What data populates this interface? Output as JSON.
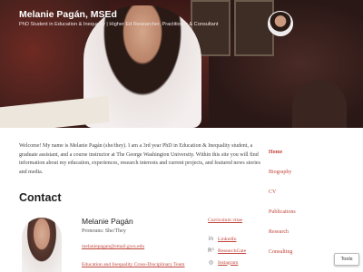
{
  "header": {
    "site_title": "Melanie Pagán, MSEd",
    "tagline": "PhD Student in Education & Inequality | Higher Ed Researcher, Practitioner & Consultant"
  },
  "intro": "Welcome! My name is Melanie Pagán (she/they). I am a 3rd year PhD in Education & Inequality student, a graduate assistant, and a course instructor at The George Washington University. Within this site you will find information about my education, experiences, research interests and current projects, and featured news stories and media.",
  "contact": {
    "heading": "Contact",
    "name": "Melanie Pagán",
    "pronouns": "Pronouns: She/They",
    "email": "melaniepagan@email.gwu.edu",
    "team_link": "Education and Inequality Cross-Disciplinary Team",
    "cv_link": "Curriculum vitae",
    "social": [
      {
        "icon": "linkedin-icon",
        "glyph": "in",
        "label": "LinkedIn"
      },
      {
        "icon": "researchgate-icon",
        "glyph": "Rᴳ",
        "label": "ResearchGate"
      },
      {
        "icon": "instagram-icon",
        "glyph": "◎",
        "label": "Instagram"
      }
    ]
  },
  "nav": {
    "items": [
      "Home",
      "Biography",
      "CV",
      "Publications",
      "Research",
      "Consulting"
    ],
    "active": "Home"
  },
  "tools_label": "Tools",
  "colors": {
    "link": "#c0443a",
    "header_bg": "#3a1815"
  }
}
